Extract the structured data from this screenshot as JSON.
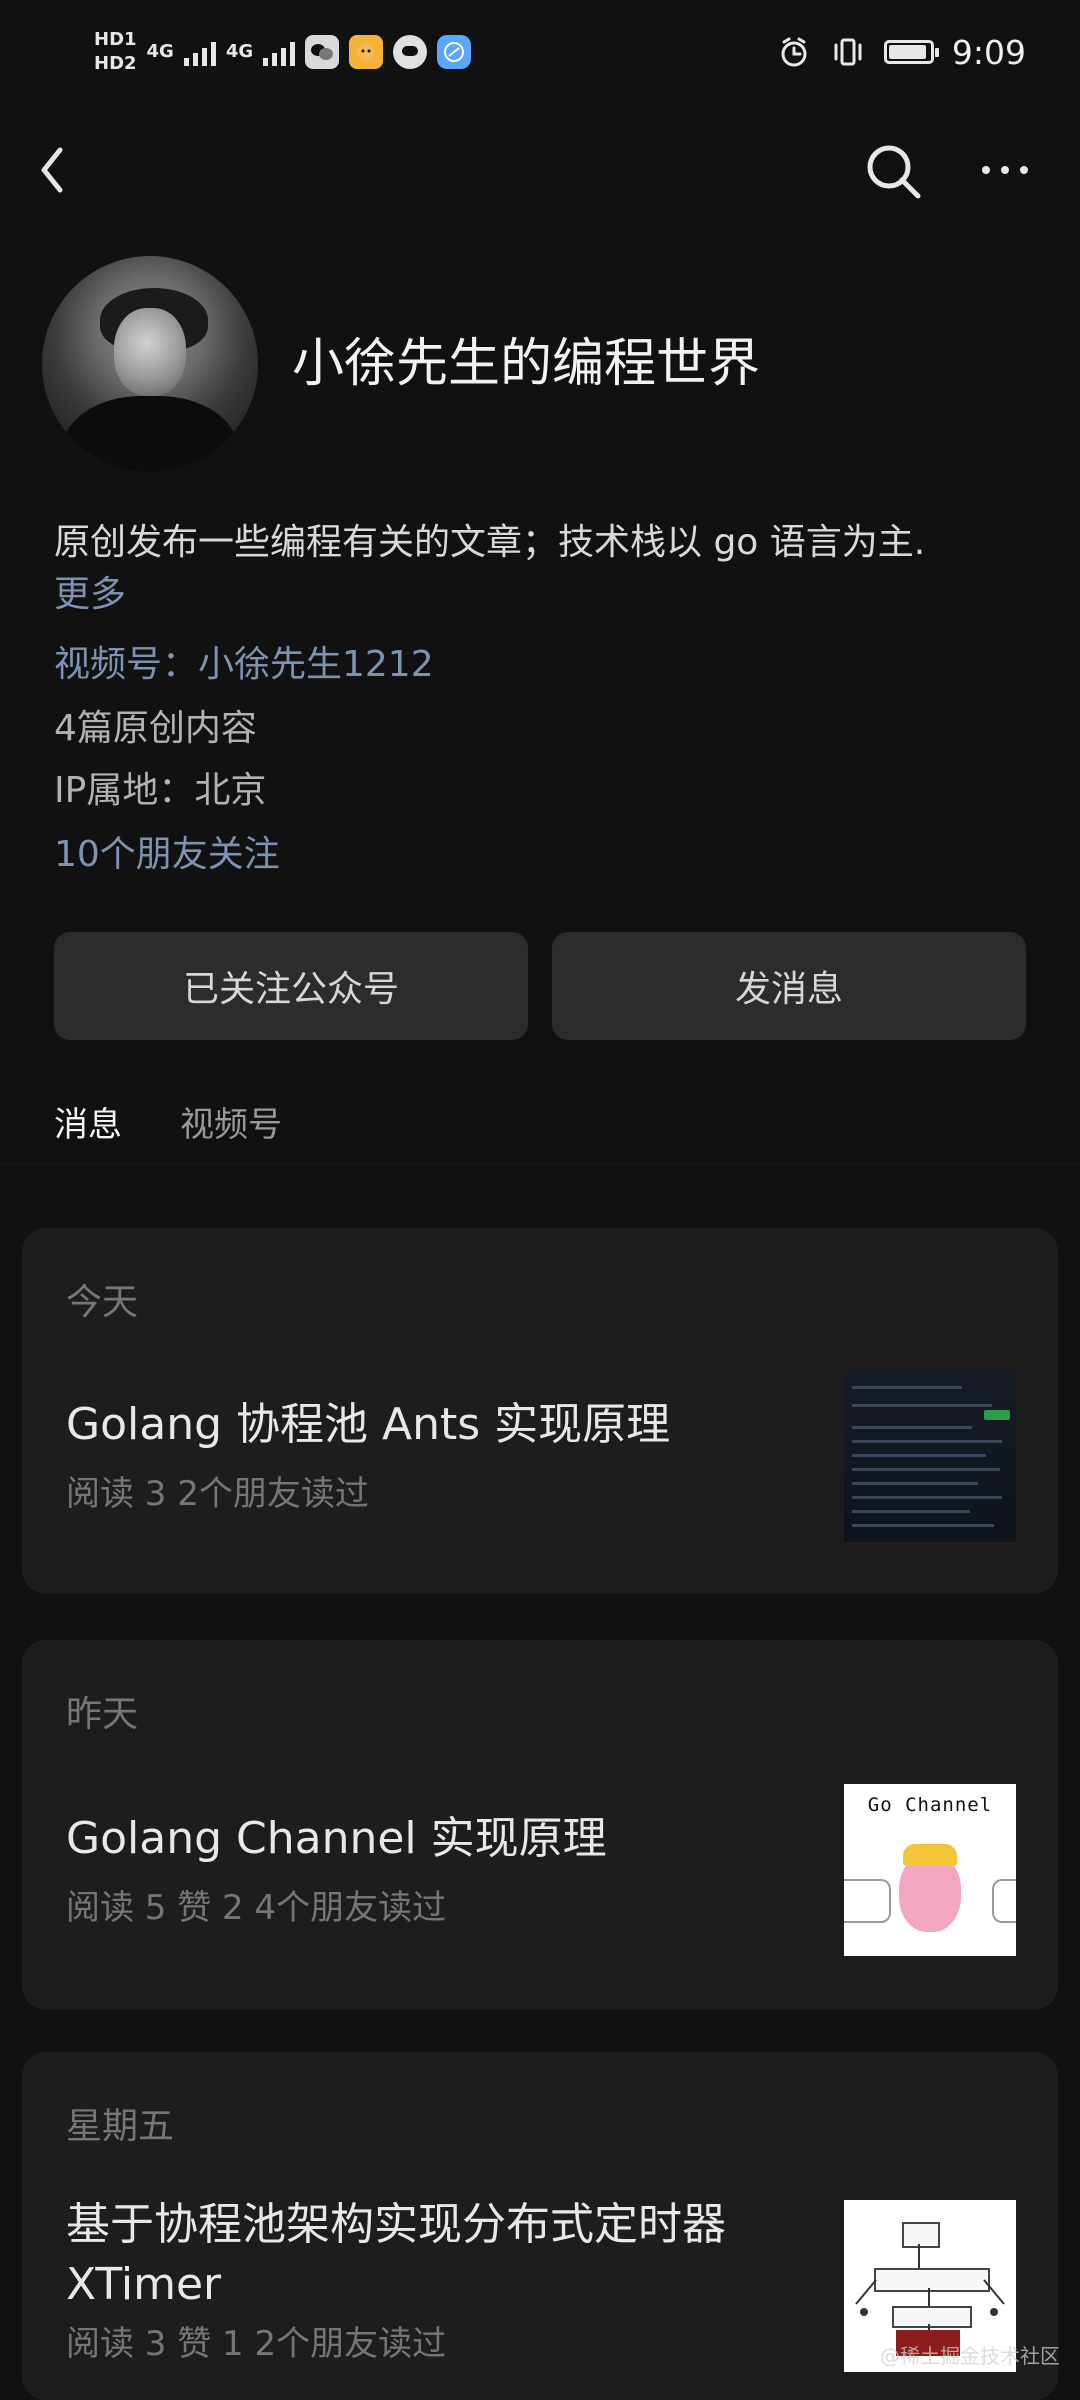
{
  "status_bar": {
    "left_labels": [
      "HD1",
      "HD2",
      "4G",
      "4G"
    ],
    "time": "9:09",
    "battery_level": 0.8,
    "icons": [
      "wechat-icon",
      "orange-app-icon",
      "message-icon",
      "browser-icon",
      "alarm-icon",
      "vibrate-icon",
      "battery-icon"
    ]
  },
  "header": {
    "back_icon": "back-icon",
    "search_icon": "search-icon",
    "more_icon": "more-icon"
  },
  "profile": {
    "name": "小徐先生的编程世界",
    "description": "原创发布一些编程有关的文章；技术栈以 go 语言为主.",
    "more_label": "更多",
    "channels_label": "视频号：小徐先生1212",
    "original_count_label": "4篇原创内容",
    "ip_location_label": "IP属地：北京",
    "friends_following_label": "10个朋友关注"
  },
  "actions": {
    "follow_label": "已关注公众号",
    "message_label": "发消息"
  },
  "tabs": [
    {
      "label": "消息",
      "active": true
    },
    {
      "label": "视频号",
      "active": false
    }
  ],
  "articles": [
    {
      "date": "今天",
      "title": "Golang 协程池 Ants 实现原理",
      "meta": "阅读 3  2个朋友读过"
    },
    {
      "date": "昨天",
      "title": "Golang Channel 实现原理",
      "meta": "阅读 5  赞 2  4个朋友读过",
      "thumbnail_label": "Go Channel"
    },
    {
      "date": "星期五",
      "title_line1": "基于协程池架构实现分布式定时器",
      "title_line2": "XTimer",
      "meta": "阅读 3  赞 1  2个朋友读过"
    }
  ],
  "watermark": "@稀土掘金技术社区"
}
